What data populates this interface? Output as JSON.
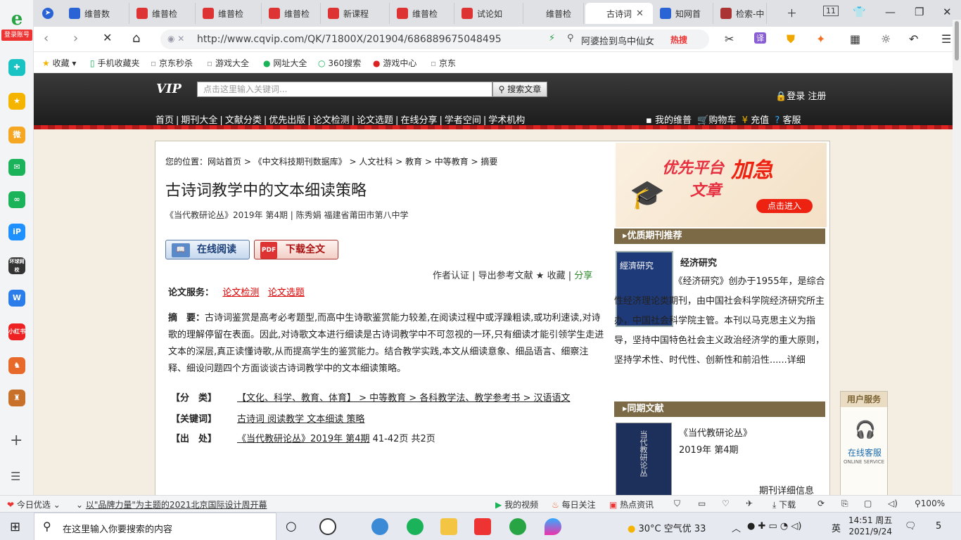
{
  "sidebar": {
    "logo_text": "e",
    "login_label": "登录账号",
    "icons": [
      "tool-icon",
      "favorites-star-icon",
      "weibo-icon",
      "mail-icon",
      "link-icon",
      "ip-icon",
      "huanqiu-icon",
      "document-icon",
      "xiaohongshu-icon",
      "game-icon",
      "game2-icon"
    ],
    "huanqiu_text": "环球网校",
    "xiaohongshu_text": "小红书"
  },
  "tabs": [
    {
      "label": "维普数",
      "icon_color": "#2a63d4"
    },
    {
      "label": "维普检",
      "icon_color": "#d33"
    },
    {
      "label": "维普检",
      "icon_color": "#d33"
    },
    {
      "label": "维普检",
      "icon_color": "#d33"
    },
    {
      "label": "新课程",
      "icon_color": "#d33"
    },
    {
      "label": "维普检",
      "icon_color": "#d33"
    },
    {
      "label": "试论如",
      "icon_color": "#d33"
    },
    {
      "label": "维普检",
      "icon_color": "#dfe1e5"
    },
    {
      "label": "古诗词",
      "icon_color": "#ffffff"
    },
    {
      "label": "知网首",
      "icon_color": "#2a63d4"
    },
    {
      "label": "检索-中",
      "icon_color": "#a33"
    }
  ],
  "tab_counter": "11",
  "address": {
    "url": "http://www.cqvip.com/QK/71800X/201904/686889675048495",
    "search_text": "阿婆捡到鸟中仙女",
    "hot_label": "热搜"
  },
  "bookmarks": [
    {
      "label": "收藏"
    },
    {
      "label": "手机收藏夹"
    },
    {
      "label": "京东秒杀"
    },
    {
      "label": "游戏大全"
    },
    {
      "label": "网址大全"
    },
    {
      "label": "360搜索"
    },
    {
      "label": "游戏中心"
    },
    {
      "label": "京东"
    }
  ],
  "vip": {
    "logo": "VIP",
    "search_placeholder": "点击这里输入关键词...",
    "search_button": "搜索文章",
    "login": "登录 注册",
    "nav": [
      "首页",
      "期刊大全",
      "文献分类",
      "优先出版",
      "论文检测",
      "论文选题",
      "在线分享",
      "学者空间",
      "学术机构"
    ],
    "links": [
      "我的维普",
      "购物车",
      "充值",
      "客服"
    ]
  },
  "article": {
    "breadcrumb": "您的位置：网站首页 > 《中文科技期刊数据库》 > 人文社科 > 教育 > 中等教育 > 摘要",
    "title": "古诗词教学中的文本细读策略",
    "meta": "《当代教研论丛》2019年 第4期 | 陈秀娟    福建省莆田市第八中学",
    "read_online": "在线阅读",
    "download": "下载全文",
    "actions_prefix": "作者认证 | 导出参考文献 ★ 收藏 | ",
    "share": "分享",
    "services_label": "论文服务：",
    "service_links": [
      "论文检测",
      "论文选题"
    ],
    "abstract_label": "摘　要：",
    "abstract": "古诗词鉴赏是高考必考题型,而高中生诗歌鉴赏能力较差,在阅读过程中或浮躁粗读,或功利速读,对诗歌的理解停留在表面。因此,对诗歌文本进行细读是古诗词教学中不可忽视的一环,只有细读才能引领学生走进文本的深层,真正读懂诗歌,从而提高学生的鉴赏能力。结合教学实践,本文从细读意象、细品语言、细察注释、细设问题四个方面谈谈古诗词教学中的文本细读策略。",
    "classification_label": "【分　类】",
    "classification": "【文化、科学、教育、体育】 > 中等教育 > 各科教学法、教学参考书 > 汉语语文",
    "keywords_label": "【关键词】",
    "keywords": "古诗词 阅读教学 文本细读 策略",
    "source_label": "【出　处】",
    "source_link": "《当代教研论丛》2019年 第4期",
    "source_pages": " 41-42页 共2页"
  },
  "right": {
    "ad_t1": "优先平台",
    "ad_t1b": "文章",
    "ad_t2": "加急",
    "ad_btn": "点击进入",
    "recommend_header": "优质期刊推荐",
    "journal_name": "经济研究",
    "journal_desc": "　　　　　　　《经济研究》创办于1955年，是综合性经济理论类期刊，由中国社会科学院经济研究所主办，中国社会科学院主管。本刊以马克思主义为指导，坚持中国特色社会主义政治经济学的重大原则，坚持学术性、时代性、创新性和前沿性......详细",
    "same_header": "同期文献",
    "same_title": "《当代教研论丛》",
    "same_issue": "2019年 第4期",
    "same_more": "期刊详细信息"
  },
  "userservice": {
    "header": "用户服务",
    "title": "在线客服",
    "subtitle": "ONLINE SERVICE"
  },
  "statusbar": {
    "today": "今日优选",
    "news": "以\"品牌力量\"为主题的2021北京国际设计周开幕",
    "video": "我的视频",
    "daily": "每日关注",
    "hot": "热点资讯",
    "download": "下载",
    "zoom": "100%"
  },
  "taskbar": {
    "search_placeholder": "在这里输入你要搜索的内容",
    "temperature": "30°C",
    "air": "空气优 33",
    "ime": "英",
    "time": "14:51 周五",
    "date": "2021/9/24",
    "notify_count": "5"
  }
}
